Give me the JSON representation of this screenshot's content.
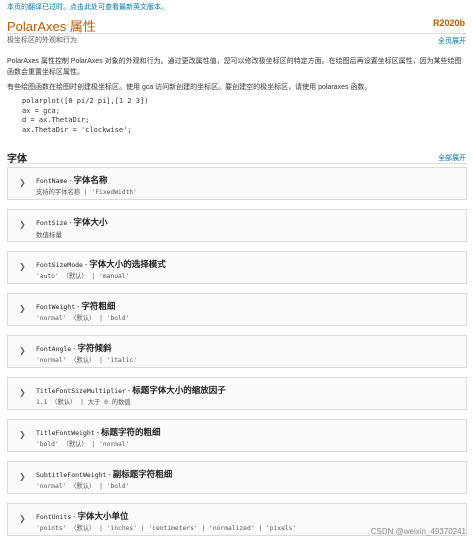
{
  "notice": "本页的翻译已过时。点击此处可查看最新英文版本。",
  "title": "PolarAxes 属性",
  "release": "R2020b",
  "subtitle": "极坐标区的外观和行为",
  "expand_all_top": "全页展开",
  "para1": "PolarAxes 属性控制 PolarAxes 对象的外观和行为。通过更改属性值，您可以修改极坐标区的特定方面。在绘图后再设置坐标区属性，因为某些绘图函数会重置坐标区属性。",
  "para2": "有些绘图函数在绘图时创建极坐标区。使用 gca 访问新创建的坐标区。要创建空的极坐标区，请使用 polaraxes 函数。",
  "code": "polarplot([0 pi/2 pi],[1 2 3])\nax = gca;\nd = ax.ThetaDir;\nax.ThetaDir = 'clockwise';",
  "section_title": "字体",
  "expand_all": "全部展开",
  "properties": [
    {
      "name": "FontName",
      "sep": " - ",
      "desc": "字体名称",
      "values": "支持的字体名称 | 'FixedWidth'"
    },
    {
      "name": "FontSize",
      "sep": " - ",
      "desc": "字体大小",
      "values": "数值标量"
    },
    {
      "name": "FontSizeMode",
      "sep": " - ",
      "desc": "字体大小的选择模式",
      "values": "'auto' （默认） | 'manual'"
    },
    {
      "name": "FontWeight",
      "sep": " - ",
      "desc": "字符粗细",
      "values": "'normal' （默认） | 'bold'"
    },
    {
      "name": "FontAngle",
      "sep": " - ",
      "desc": "字符倾斜",
      "values": "'normal' （默认） | 'italic'"
    },
    {
      "name": "TitleFontSizeMultiplier",
      "sep": " - ",
      "desc": "标题字体大小的缩放因子",
      "values": "1.1 （默认） | 大于 0 的数值"
    },
    {
      "name": "TitleFontWeight",
      "sep": " - ",
      "desc": "标题字符的粗细",
      "values": "'bold' （默认） | 'normal'"
    },
    {
      "name": "SubtitleFontWeight",
      "sep": " - ",
      "desc": "副标题字符粗细",
      "values": "'normal' （默认） | 'bold'"
    },
    {
      "name": "FontUnits",
      "sep": " - ",
      "desc": "字体大小单位",
      "values": "'points' （默认） | 'inches' | 'centimeters' | 'normalized' | 'pixels'"
    }
  ],
  "watermark": "CSDN @weixin_49370241"
}
